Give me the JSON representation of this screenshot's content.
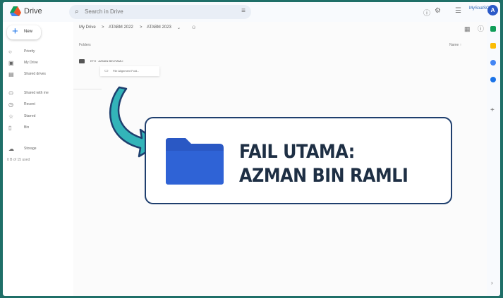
{
  "app": {
    "brand": "Drive"
  },
  "search": {
    "placeholder": "Search in Drive",
    "filter_icon": "tune-icon"
  },
  "topbar": {
    "account_chip": "MySoalSC*",
    "avatar_letter": "A"
  },
  "sidebar": {
    "new_label": "New",
    "items": [
      {
        "icon": "home-icon",
        "label": "Priority"
      },
      {
        "icon": "my-drive-icon",
        "label": "My Drive"
      },
      {
        "icon": "shared-drives-icon",
        "label": "Shared drives"
      },
      {
        "icon": "shared-with-me-icon",
        "label": "Shared with me"
      },
      {
        "icon": "recent-icon",
        "label": "Recent"
      },
      {
        "icon": "starred-icon",
        "label": "Starred"
      },
      {
        "icon": "bin-icon",
        "label": "Bin"
      },
      {
        "icon": "storage-icon",
        "label": "Storage"
      }
    ],
    "storage_used": "0 B of 15 used"
  },
  "breadcrumb": [
    "My Drive",
    ">",
    "ATABM 2022",
    ">",
    "ATABM 2023"
  ],
  "main": {
    "folders_label": "Folders",
    "sort_label": "Name ↑",
    "folder_row": "ETH · AZMAN BIN RAMLI",
    "context_text": "File Alignment Fold..."
  },
  "callout": {
    "line1": "FAIL UTAMA:",
    "line2": "AZMAN BIN RAMLI"
  },
  "colors": {
    "border": "#1f6f68",
    "arrow": "#33b4b9",
    "folder": "#2a58c4",
    "callout_border": "#1f3f6e",
    "callout_text": "#1e2f44"
  }
}
